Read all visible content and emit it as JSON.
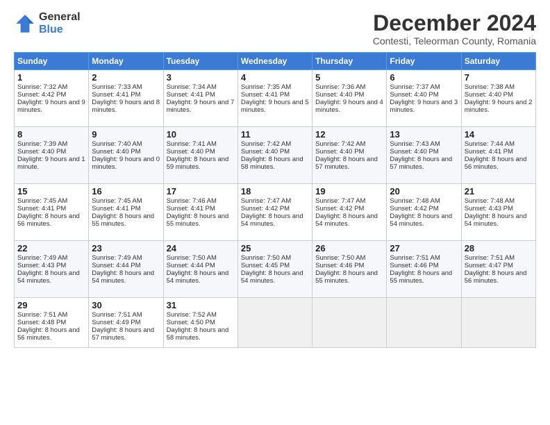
{
  "logo": {
    "general": "General",
    "blue": "Blue"
  },
  "header": {
    "month": "December 2024",
    "location": "Contesti, Teleorman County, Romania"
  },
  "weekdays": [
    "Sunday",
    "Monday",
    "Tuesday",
    "Wednesday",
    "Thursday",
    "Friday",
    "Saturday"
  ],
  "weeks": [
    [
      {
        "day": "1",
        "sunrise": "Sunrise: 7:32 AM",
        "sunset": "Sunset: 4:42 PM",
        "daylight": "Daylight: 9 hours and 9 minutes."
      },
      {
        "day": "2",
        "sunrise": "Sunrise: 7:33 AM",
        "sunset": "Sunset: 4:41 PM",
        "daylight": "Daylight: 9 hours and 8 minutes."
      },
      {
        "day": "3",
        "sunrise": "Sunrise: 7:34 AM",
        "sunset": "Sunset: 4:41 PM",
        "daylight": "Daylight: 9 hours and 7 minutes."
      },
      {
        "day": "4",
        "sunrise": "Sunrise: 7:35 AM",
        "sunset": "Sunset: 4:41 PM",
        "daylight": "Daylight: 9 hours and 5 minutes."
      },
      {
        "day": "5",
        "sunrise": "Sunrise: 7:36 AM",
        "sunset": "Sunset: 4:40 PM",
        "daylight": "Daylight: 9 hours and 4 minutes."
      },
      {
        "day": "6",
        "sunrise": "Sunrise: 7:37 AM",
        "sunset": "Sunset: 4:40 PM",
        "daylight": "Daylight: 9 hours and 3 minutes."
      },
      {
        "day": "7",
        "sunrise": "Sunrise: 7:38 AM",
        "sunset": "Sunset: 4:40 PM",
        "daylight": "Daylight: 9 hours and 2 minutes."
      }
    ],
    [
      {
        "day": "8",
        "sunrise": "Sunrise: 7:39 AM",
        "sunset": "Sunset: 4:40 PM",
        "daylight": "Daylight: 9 hours and 1 minute."
      },
      {
        "day": "9",
        "sunrise": "Sunrise: 7:40 AM",
        "sunset": "Sunset: 4:40 PM",
        "daylight": "Daylight: 9 hours and 0 minutes."
      },
      {
        "day": "10",
        "sunrise": "Sunrise: 7:41 AM",
        "sunset": "Sunset: 4:40 PM",
        "daylight": "Daylight: 8 hours and 59 minutes."
      },
      {
        "day": "11",
        "sunrise": "Sunrise: 7:42 AM",
        "sunset": "Sunset: 4:40 PM",
        "daylight": "Daylight: 8 hours and 58 minutes."
      },
      {
        "day": "12",
        "sunrise": "Sunrise: 7:42 AM",
        "sunset": "Sunset: 4:40 PM",
        "daylight": "Daylight: 8 hours and 57 minutes."
      },
      {
        "day": "13",
        "sunrise": "Sunrise: 7:43 AM",
        "sunset": "Sunset: 4:40 PM",
        "daylight": "Daylight: 8 hours and 57 minutes."
      },
      {
        "day": "14",
        "sunrise": "Sunrise: 7:44 AM",
        "sunset": "Sunset: 4:41 PM",
        "daylight": "Daylight: 8 hours and 56 minutes."
      }
    ],
    [
      {
        "day": "15",
        "sunrise": "Sunrise: 7:45 AM",
        "sunset": "Sunset: 4:41 PM",
        "daylight": "Daylight: 8 hours and 56 minutes."
      },
      {
        "day": "16",
        "sunrise": "Sunrise: 7:45 AM",
        "sunset": "Sunset: 4:41 PM",
        "daylight": "Daylight: 8 hours and 55 minutes."
      },
      {
        "day": "17",
        "sunrise": "Sunrise: 7:46 AM",
        "sunset": "Sunset: 4:41 PM",
        "daylight": "Daylight: 8 hours and 55 minutes."
      },
      {
        "day": "18",
        "sunrise": "Sunrise: 7:47 AM",
        "sunset": "Sunset: 4:42 PM",
        "daylight": "Daylight: 8 hours and 54 minutes."
      },
      {
        "day": "19",
        "sunrise": "Sunrise: 7:47 AM",
        "sunset": "Sunset: 4:42 PM",
        "daylight": "Daylight: 8 hours and 54 minutes."
      },
      {
        "day": "20",
        "sunrise": "Sunrise: 7:48 AM",
        "sunset": "Sunset: 4:42 PM",
        "daylight": "Daylight: 8 hours and 54 minutes."
      },
      {
        "day": "21",
        "sunrise": "Sunrise: 7:48 AM",
        "sunset": "Sunset: 4:43 PM",
        "daylight": "Daylight: 8 hours and 54 minutes."
      }
    ],
    [
      {
        "day": "22",
        "sunrise": "Sunrise: 7:49 AM",
        "sunset": "Sunset: 4:43 PM",
        "daylight": "Daylight: 8 hours and 54 minutes."
      },
      {
        "day": "23",
        "sunrise": "Sunrise: 7:49 AM",
        "sunset": "Sunset: 4:44 PM",
        "daylight": "Daylight: 8 hours and 54 minutes."
      },
      {
        "day": "24",
        "sunrise": "Sunrise: 7:50 AM",
        "sunset": "Sunset: 4:44 PM",
        "daylight": "Daylight: 8 hours and 54 minutes."
      },
      {
        "day": "25",
        "sunrise": "Sunrise: 7:50 AM",
        "sunset": "Sunset: 4:45 PM",
        "daylight": "Daylight: 8 hours and 54 minutes."
      },
      {
        "day": "26",
        "sunrise": "Sunrise: 7:50 AM",
        "sunset": "Sunset: 4:46 PM",
        "daylight": "Daylight: 8 hours and 55 minutes."
      },
      {
        "day": "27",
        "sunrise": "Sunrise: 7:51 AM",
        "sunset": "Sunset: 4:46 PM",
        "daylight": "Daylight: 8 hours and 55 minutes."
      },
      {
        "day": "28",
        "sunrise": "Sunrise: 7:51 AM",
        "sunset": "Sunset: 4:47 PM",
        "daylight": "Daylight: 8 hours and 56 minutes."
      }
    ],
    [
      {
        "day": "29",
        "sunrise": "Sunrise: 7:51 AM",
        "sunset": "Sunset: 4:48 PM",
        "daylight": "Daylight: 8 hours and 56 minutes."
      },
      {
        "day": "30",
        "sunrise": "Sunrise: 7:51 AM",
        "sunset": "Sunset: 4:49 PM",
        "daylight": "Daylight: 8 hours and 57 minutes."
      },
      {
        "day": "31",
        "sunrise": "Sunrise: 7:52 AM",
        "sunset": "Sunset: 4:50 PM",
        "daylight": "Daylight: 8 hours and 58 minutes."
      },
      null,
      null,
      null,
      null
    ]
  ]
}
